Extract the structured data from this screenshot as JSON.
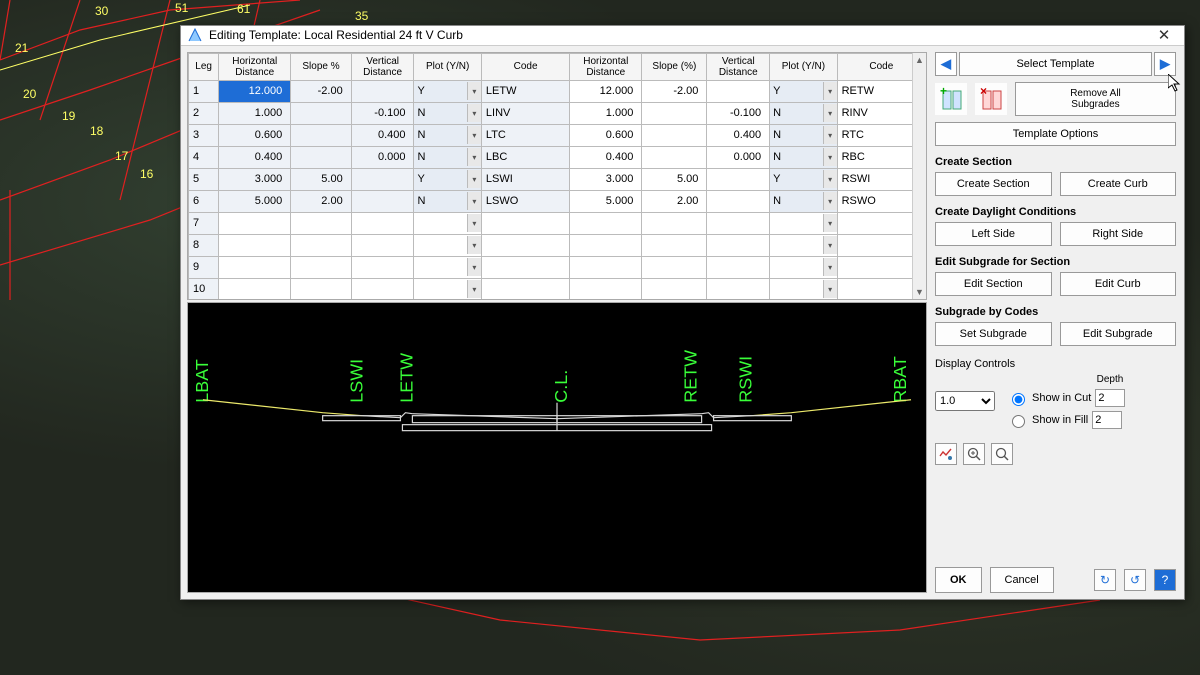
{
  "window": {
    "title": "Editing Template: Local Residential 24 ft V Curb"
  },
  "table": {
    "headers": {
      "leg": "Leg",
      "hdist": "Horizontal\nDistance",
      "slope_pct": "Slope %",
      "vdist": "Vertical\nDistance",
      "plot": "Plot (Y/N)",
      "code": "Code",
      "hdist2": "Horizontal\nDistance",
      "slope_pct2": "Slope (%)",
      "vdist2": "Vertical\nDistance",
      "plot2": "Plot (Y/N)",
      "code2": "Code"
    },
    "rows": [
      {
        "leg": "1",
        "hdist": "12.000",
        "slope": "-2.00",
        "vdist": "",
        "plot": "Y",
        "code": "LETW",
        "hdist2": "12.000",
        "slope2": "-2.00",
        "vdist2": "",
        "plot2": "Y",
        "code2": "RETW",
        "selected": true
      },
      {
        "leg": "2",
        "hdist": "1.000",
        "slope": "",
        "vdist": "-0.100",
        "plot": "N",
        "code": "LINV",
        "hdist2": "1.000",
        "slope2": "",
        "vdist2": "-0.100",
        "plot2": "N",
        "code2": "RINV"
      },
      {
        "leg": "3",
        "hdist": "0.600",
        "slope": "",
        "vdist": "0.400",
        "plot": "N",
        "code": "LTC",
        "hdist2": "0.600",
        "slope2": "",
        "vdist2": "0.400",
        "plot2": "N",
        "code2": "RTC"
      },
      {
        "leg": "4",
        "hdist": "0.400",
        "slope": "",
        "vdist": "0.000",
        "plot": "N",
        "code": "LBC",
        "hdist2": "0.400",
        "slope2": "",
        "vdist2": "0.000",
        "plot2": "N",
        "code2": "RBC"
      },
      {
        "leg": "5",
        "hdist": "3.000",
        "slope": "5.00",
        "vdist": "",
        "plot": "Y",
        "code": "LSWI",
        "hdist2": "3.000",
        "slope2": "5.00",
        "vdist2": "",
        "plot2": "Y",
        "code2": "RSWI"
      },
      {
        "leg": "6",
        "hdist": "5.000",
        "slope": "2.00",
        "vdist": "",
        "plot": "N",
        "code": "LSWO",
        "hdist2": "5.000",
        "slope2": "2.00",
        "vdist2": "",
        "plot2": "N",
        "code2": "RSWO"
      },
      {
        "leg": "7"
      },
      {
        "leg": "8"
      },
      {
        "leg": "9"
      },
      {
        "leg": "10"
      }
    ]
  },
  "section_labels": [
    "LBAT",
    "LSWI",
    "LETW",
    "C.L.",
    "RETW",
    "RSWI",
    "RBAT"
  ],
  "side": {
    "select_template": "Select Template",
    "remove_all": "Remove All\nSubgrades",
    "template_options": "Template Options",
    "create_section_hdr": "Create Section",
    "create_section_btn": "Create Section",
    "create_curb_btn": "Create Curb",
    "daylight_hdr": "Create Daylight Conditions",
    "left_side": "Left Side",
    "right_side": "Right Side",
    "edit_sub_hdr": "Edit Subgrade for Section",
    "edit_section": "Edit Section",
    "edit_curb": "Edit Curb",
    "sub_codes_hdr": "Subgrade by Codes",
    "set_subgrade": "Set Subgrade",
    "edit_subgrade": "Edit Subgrade",
    "display_controls": "Display Controls",
    "depth_label": "Depth",
    "scale": "1.0",
    "show_in_cut": "Show in Cut",
    "show_in_fill": "Show in Fill",
    "depth_cut": "2",
    "depth_fill": "2",
    "ok": "OK",
    "cancel": "Cancel"
  },
  "map": {
    "lot_numbers": [
      "30",
      "51",
      "61",
      "35",
      "21",
      "20",
      "19",
      "18",
      "17",
      "16"
    ]
  }
}
